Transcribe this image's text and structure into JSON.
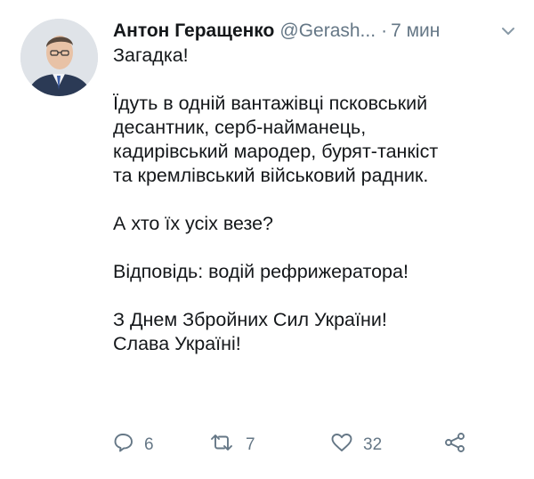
{
  "tweet": {
    "author_name": "Антон Геращенко",
    "handle": "@Gerash...",
    "separator": "·",
    "time": "7 мин",
    "body": [
      [
        "Загадка!"
      ],
      [
        "Їдуть в одній вантажівці псковський",
        "десантник, серб-найманець,",
        "кадирівський мародер, бурят-танкіст",
        "та кремлівський військовий радник."
      ],
      [
        "А хто їх усіх везе?"
      ],
      [
        "Відповідь: водій рефрижератора!"
      ],
      [
        "З Днем Збройних Сил України!",
        "Слава Україні!"
      ]
    ],
    "actions": {
      "reply_count": "6",
      "retweet_count": "7",
      "like_count": "32"
    }
  },
  "icons": {
    "more": "chevron-down-icon",
    "reply": "reply-icon",
    "retweet": "retweet-icon",
    "like": "heart-icon",
    "share": "share-icon"
  },
  "colors": {
    "text": "#14171a",
    "secondary": "#657786",
    "background": "#ffffff"
  }
}
